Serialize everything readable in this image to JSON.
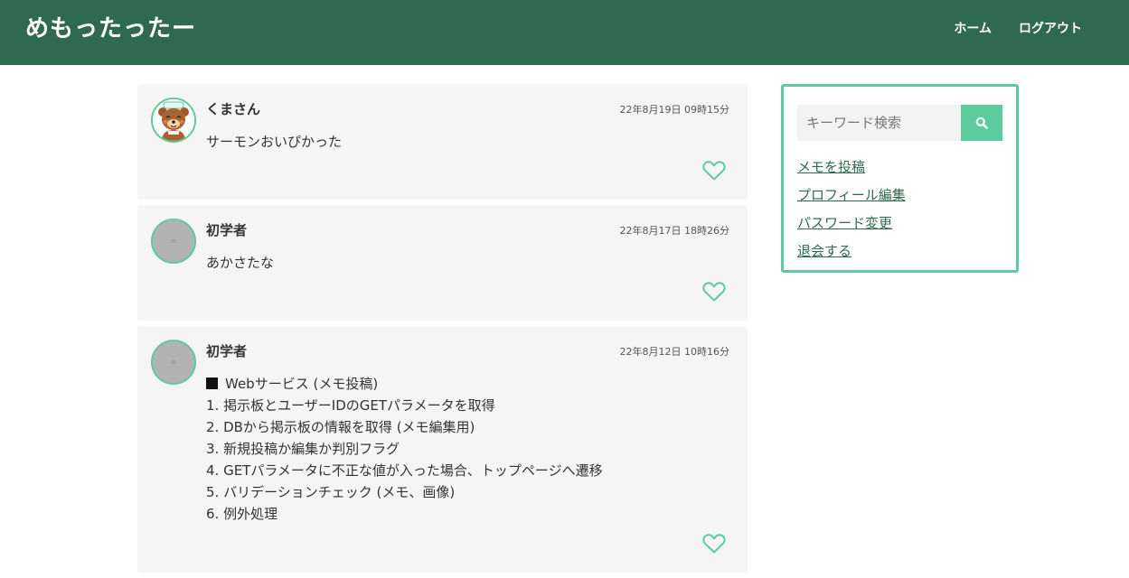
{
  "app": {
    "logo": "めもったったー"
  },
  "nav": {
    "home": "ホーム",
    "logout": "ログアウト"
  },
  "posts": [
    {
      "user": "くまさん",
      "date": "22年8月19日 09時15分",
      "lines": [
        "サーモンおいぴかった"
      ],
      "avatar": "bear"
    },
    {
      "user": "初学者",
      "date": "22年8月17日 18時26分",
      "lines": [
        "あかさたな"
      ],
      "avatar": "default"
    },
    {
      "user": "初学者",
      "date": "22年8月12日 10時16分",
      "lines": [
        "Webサービス (メモ投稿)",
        "1. 掲示板とユーザーIDのGETパラメータを取得",
        "2. DBから掲示板の情報を取得 (メモ編集用)",
        "3. 新規投稿か編集か判別フラグ",
        "4. GETパラメータに不正な値が入った場合、トップページへ遷移",
        "5. バリデーションチェック (メモ、画像)",
        "6. 例外処理"
      ],
      "avatar": "default"
    }
  ],
  "sidebar": {
    "search_placeholder": "キーワード検索",
    "links": [
      "メモを投稿",
      "プロフィール編集",
      "パスワード変更",
      "退会する"
    ]
  },
  "colors": {
    "header": "#2f6a50",
    "accent": "#5ccb9d",
    "card": "#f5f5f5",
    "link": "#2f6a50"
  },
  "icons": {
    "search": "search-icon",
    "like": "heart-icon"
  }
}
